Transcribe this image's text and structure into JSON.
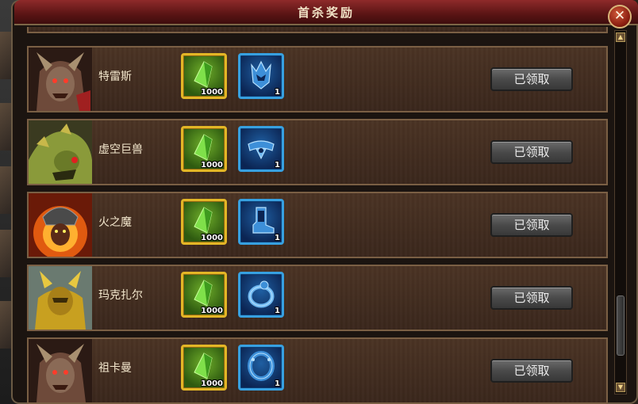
{
  "window": {
    "title": "首杀奖励",
    "close_label": "✕"
  },
  "rows": [
    {
      "boss": "特雷斯",
      "portrait_icon": "demon-lord-portrait-icon",
      "reward_gold": {
        "icon": "green-crystal-icon",
        "qty": "1000"
      },
      "reward_blue": {
        "icon": "demon-helmet-icon",
        "qty": "1"
      },
      "button": "已领取"
    },
    {
      "boss": "虚空巨兽",
      "portrait_icon": "void-beast-portrait-icon",
      "reward_gold": {
        "icon": "green-crystal-icon",
        "qty": "1000"
      },
      "reward_blue": {
        "icon": "winged-belt-icon",
        "qty": "1"
      },
      "button": "已领取"
    },
    {
      "boss": "火之魔",
      "portrait_icon": "fire-demon-portrait-icon",
      "reward_gold": {
        "icon": "green-crystal-icon",
        "qty": "1000"
      },
      "reward_blue": {
        "icon": "armored-boot-icon",
        "qty": "1"
      },
      "button": "已领取"
    },
    {
      "boss": "玛克扎尔",
      "portrait_icon": "golden-knight-portrait-icon",
      "reward_gold": {
        "icon": "green-crystal-icon",
        "qty": "1000"
      },
      "reward_blue": {
        "icon": "ring-icon",
        "qty": "1"
      },
      "button": "已领取"
    },
    {
      "boss": "祖卡曼",
      "portrait_icon": "demon-lord-portrait-icon",
      "reward_gold": {
        "icon": "green-crystal-icon",
        "qty": "1000"
      },
      "reward_blue": {
        "icon": "bracer-icon",
        "qty": "1"
      },
      "button": "已领取"
    }
  ],
  "colors": {
    "title_bar": "#8e2a2a",
    "gold_border": "#e3b626",
    "blue_border": "#37a0e0",
    "row_bg": "#4a3324"
  }
}
